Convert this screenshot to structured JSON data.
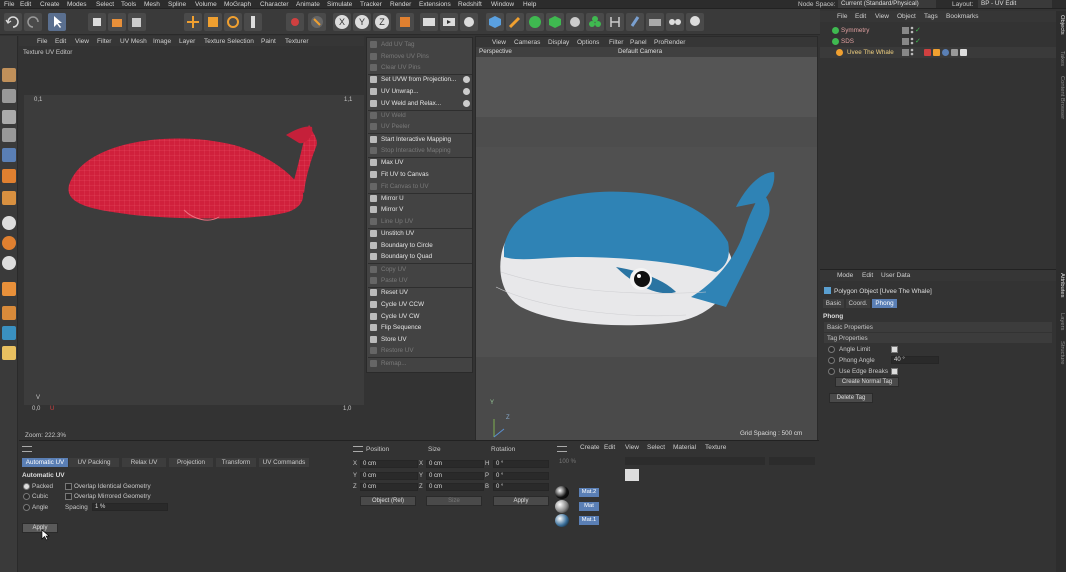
{
  "menubar": {
    "items": [
      "File",
      "Edit",
      "Create",
      "Modes",
      "Select",
      "Tools",
      "Mesh",
      "Spline",
      "Volume",
      "MoGraph",
      "Character",
      "Animate",
      "Simulate",
      "Tracker",
      "Render",
      "Extensions",
      "Redshift",
      "Window",
      "Help"
    ],
    "node_space_label": "Node Space:",
    "node_space_value": "Current (Standard/Physical)",
    "layout_label": "Layout:",
    "layout_value": "BP - UV Edit"
  },
  "uv_editor": {
    "menu": [
      "File",
      "Edit",
      "View",
      "Filter",
      "UV Mesh",
      "Image",
      "Layer",
      "Texture Selection",
      "Paint",
      "Texturer"
    ],
    "title": "Texture UV Editor",
    "coord_top_left": "0,1",
    "coord_top_right": "1,1",
    "coord_bottom_left": "0,0",
    "coord_bottom_right": "1,0",
    "axis_v": "V",
    "axis_u": "U",
    "zoom": "Zoom: 222.3%"
  },
  "context_menu": {
    "items": [
      {
        "label": "Add UV Tag",
        "enabled": false
      },
      {
        "label": "Remove UV Pins",
        "enabled": false
      },
      {
        "label": "Clear UV Pins",
        "enabled": false
      },
      {
        "label": "Set UVW from Projection...",
        "enabled": true,
        "gear": true
      },
      {
        "label": "UV Unwrap...",
        "enabled": true,
        "gear": true
      },
      {
        "label": "UV Weld and Relax...",
        "enabled": true,
        "gear": true
      },
      {
        "label": "UV Weld",
        "enabled": false
      },
      {
        "label": "UV Peeler",
        "enabled": false
      },
      {
        "label": "Start Interactive Mapping",
        "enabled": true
      },
      {
        "label": "Stop Interactive Mapping",
        "enabled": false
      },
      {
        "label": "Max UV",
        "enabled": true
      },
      {
        "label": "Fit UV to Canvas",
        "enabled": true
      },
      {
        "label": "Fit Canvas to UV",
        "enabled": false
      },
      {
        "label": "Mirror U",
        "enabled": true
      },
      {
        "label": "Mirror V",
        "enabled": true
      },
      {
        "label": "Line Up UV",
        "enabled": false
      },
      {
        "label": "Unstitch UV",
        "enabled": true
      },
      {
        "label": "Boundary to Circle",
        "enabled": true
      },
      {
        "label": "Boundary to Quad",
        "enabled": true
      },
      {
        "label": "Copy UV",
        "enabled": false
      },
      {
        "label": "Paste UV",
        "enabled": false
      },
      {
        "label": "Reset UV",
        "enabled": true
      },
      {
        "label": "Cycle UV CCW",
        "enabled": true
      },
      {
        "label": "Cycle UV CW",
        "enabled": true
      },
      {
        "label": "Flip Sequence",
        "enabled": true
      },
      {
        "label": "Store UV",
        "enabled": true
      },
      {
        "label": "Restore UV",
        "enabled": false
      },
      {
        "label": "Remap...",
        "enabled": false
      }
    ]
  },
  "viewport": {
    "menu": [
      "View",
      "Cameras",
      "Display",
      "Options",
      "Filter",
      "Panel",
      "ProRender"
    ],
    "name": "Perspective",
    "camera": "Default Camera",
    "grid_spacing": "Grid Spacing : 500 cm",
    "axis_y": "Y",
    "axis_z": "Z"
  },
  "object_manager": {
    "menu": [
      "File",
      "Edit",
      "View",
      "Object",
      "Tags",
      "Bookmarks"
    ],
    "objects": [
      {
        "name": "Symmetry",
        "color": "#3fb950"
      },
      {
        "name": "SDS",
        "color": "#3fb950"
      },
      {
        "name": "Uvee The Whale",
        "color": "#f0a030"
      }
    ]
  },
  "attributes": {
    "menu": [
      "Mode",
      "Edit",
      "User Data"
    ],
    "object_title": "Polygon Object [Uvee The Whale]",
    "tabs": [
      "Basic",
      "Coord.",
      "Phong"
    ],
    "active_tab": "Phong",
    "section": "Phong",
    "groups": [
      "Basic Properties",
      "Tag Properties"
    ],
    "angle_limit_label": "Angle Limit",
    "phong_angle_label": "Phong Angle",
    "phong_angle_value": "40 °",
    "use_edge_breaks_label": "Use Edge Breaks",
    "create_normal_tag": "Create Normal Tag",
    "delete_tag": "Delete Tag"
  },
  "uv_commands": {
    "tabs": [
      "Automatic UV",
      "UV Packing",
      "Relax UV",
      "Projection",
      "Transform",
      "UV Commands"
    ],
    "active_tab": "Automatic UV",
    "heading": "Automatic UV",
    "radio_packed": "Packed",
    "radio_cubic": "Cubic",
    "radio_angle": "Angle",
    "overlap_identical": "Overlap Identical Geometry",
    "overlap_mirrored": "Overlap Mirrored Geometry",
    "spacing_label": "Spacing",
    "spacing_value": "1 %",
    "apply": "Apply"
  },
  "coordinates": {
    "headers": [
      "Position",
      "Size",
      "Rotation"
    ],
    "rows": [
      {
        "axis": "X",
        "pos": "0 cm",
        "size_axis": "X",
        "size": "0 cm",
        "rot_axis": "H",
        "rot": "0 °"
      },
      {
        "axis": "Y",
        "pos": "0 cm",
        "size_axis": "Y",
        "size": "0 cm",
        "rot_axis": "P",
        "rot": "0 °"
      },
      {
        "axis": "Z",
        "pos": "0 cm",
        "size_axis": "Z",
        "size": "0 cm",
        "rot_axis": "B",
        "rot": "0 °"
      }
    ],
    "mode": "Object (Rel)",
    "size_mode": "Size",
    "apply": "Apply"
  },
  "materials": {
    "menu": [
      "Create",
      "Edit",
      "View",
      "Select",
      "Material",
      "Texture"
    ],
    "zoom": "100 %",
    "items": [
      "Mat.2",
      "Mat",
      "Mat.1"
    ]
  },
  "right_strip_labels": [
    "Objects",
    "Takes",
    "Content Browser",
    "Attributes",
    "Layers",
    "Structure"
  ],
  "colors": {
    "accent": "#5a7fb5",
    "whale_uv": "#d0203c",
    "whale_body": "#2f83b5"
  }
}
